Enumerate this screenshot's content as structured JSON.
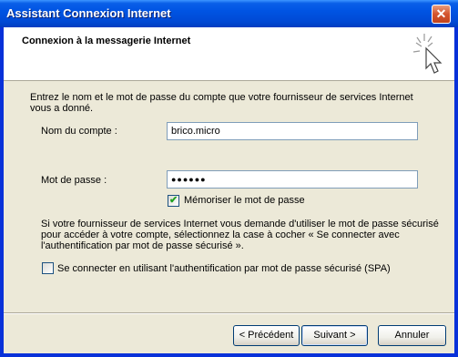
{
  "window": {
    "title": "Assistant Connexion Internet",
    "close_symbol": "✕"
  },
  "header": {
    "title": "Connexion à la messagerie Internet",
    "icon": "sparkle-cursor-icon"
  },
  "intro": {
    "line1": "Entrez le nom et le mot de passe du compte que votre fournisseur de services Internet",
    "line2": "vous a donné."
  },
  "account": {
    "label": "Nom du compte :",
    "value": "brico.micro"
  },
  "password": {
    "label": "Mot de passe :",
    "value": "●●●●●●"
  },
  "remember": {
    "label": "Mémoriser le mot de passe",
    "checked": true
  },
  "spa_info": {
    "line1": "Si votre fournisseur de services Internet vous demande d'utiliser le mot de passe sécurisé",
    "line2": "pour accéder à votre compte, sélectionnez la case à cocher « Se connecter avec",
    "line3": "l'authentification par mot de passe sécurisé »."
  },
  "spa": {
    "label": "Se connecter en utilisant l'authentification par mot de passe sécurisé (SPA)",
    "checked": false
  },
  "buttons": {
    "back": "< Précédent",
    "next": "Suivant >",
    "cancel": "Annuler"
  },
  "colors": {
    "titlebar": "#0054e3",
    "panel": "#ece9d8",
    "check": "#21a121"
  }
}
